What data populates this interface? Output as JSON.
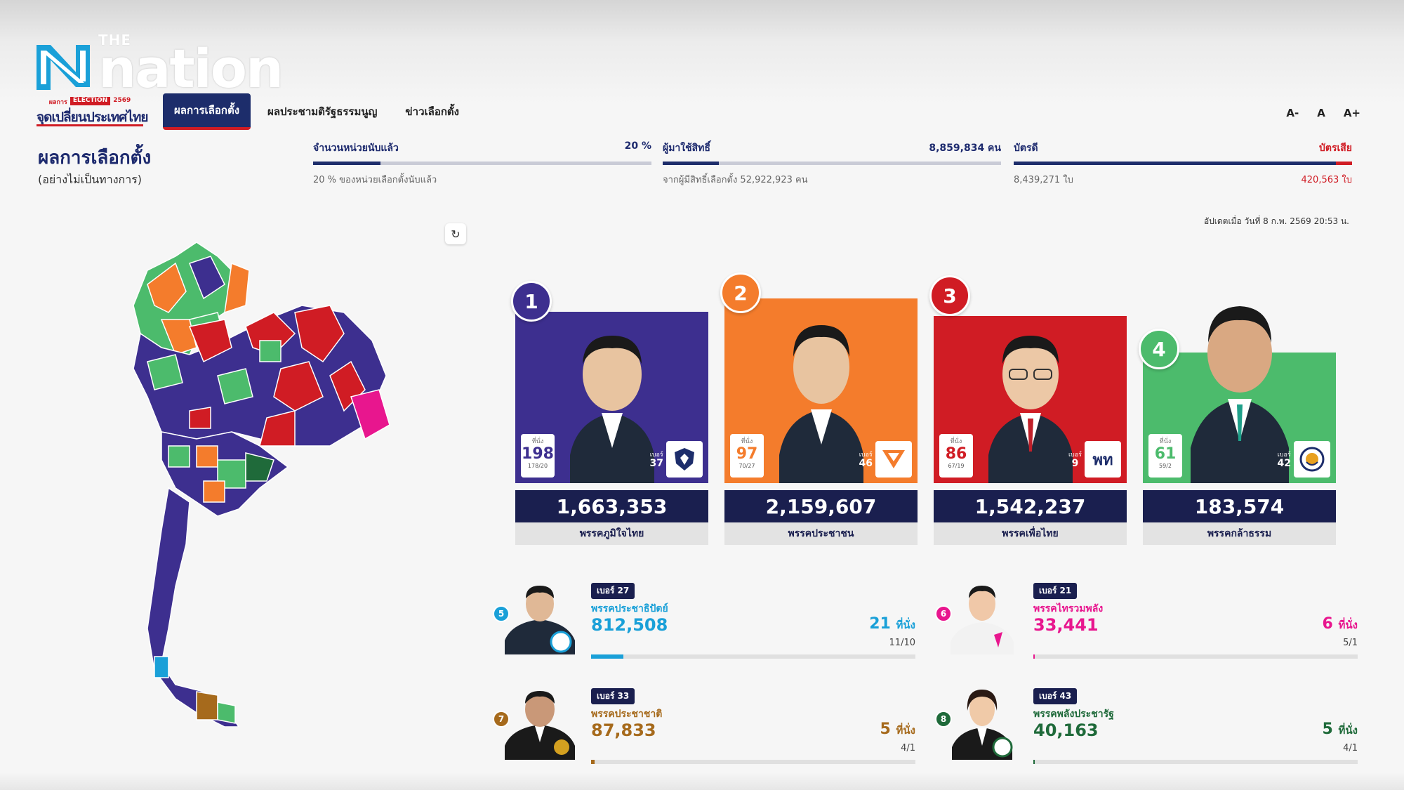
{
  "brand": {
    "the": "THE",
    "name": "nation"
  },
  "election_logo": {
    "top_left": "ผลการ",
    "badge": "ELECTION",
    "year": "2569",
    "main": "จุดเปลี่ยนประเทศไทย"
  },
  "nav": {
    "tabs": [
      {
        "label": "ผลการเลือกตั้ง",
        "active": true
      },
      {
        "label": "ผลประชามติรัฐธรรมนูญ",
        "active": false
      },
      {
        "label": "ข่าวเลือกตั้ง",
        "active": false
      }
    ]
  },
  "font_controls": [
    "A-",
    "A",
    "A+"
  ],
  "page": {
    "title": "ผลการเลือกตั้ง",
    "subtitle": "(อย่างไม่เป็นทางการ)"
  },
  "stats": {
    "counted": {
      "label": "จำนวนหน่วยนับแล้ว",
      "value": "20 %",
      "sub": "20 % ของหน่วยเลือกตั้งนับแล้ว",
      "fraction": 0.2
    },
    "voters": {
      "label": "ผู้มาใช้สิทธิ์",
      "value": "8,859,834 คน",
      "sub": "จากผู้มีสิทธิ์เลือกตั้ง 52,922,923 คน",
      "fraction": 0.167
    },
    "ballots": {
      "label": "บัตรดี",
      "label_right": "บัตรเสีย",
      "good": "8,439,271 ใบ",
      "bad": "420,563 ใบ",
      "fraction": 0.953
    }
  },
  "updated": "อัปเดตเมื่อ วันที่ 8 ก.พ. 2569 20:53 น.",
  "colors": {
    "navy": "#1a1f4f",
    "purple": "#3d2f8f",
    "orange": "#f47c2c",
    "red": "#d01c24",
    "green": "#4cbb6c",
    "pink": "#e8168e",
    "blue": "#1aa0d8",
    "brown": "#a66a1c",
    "darkgreen": "#1f6a3a"
  },
  "top_parties": [
    {
      "rank": "1",
      "party": "พรรคภูมิใจไทย",
      "votes": "1,663,353",
      "seats_label": "ที่นั่ง",
      "seats": "198",
      "seats_detail": "178/20",
      "number_label": "เบอร์",
      "number": "37",
      "logo": "shield-icon",
      "color": "#3d2f8f",
      "rank_color": "#3d2f8f"
    },
    {
      "rank": "2",
      "party": "พรรคประชาชน",
      "votes": "2,159,607",
      "seats_label": "ที่นั่ง",
      "seats": "97",
      "seats_detail": "70/27",
      "number_label": "เบอร์",
      "number": "46",
      "logo": "people-party-icon",
      "color": "#f47c2c",
      "rank_color": "#f47c2c"
    },
    {
      "rank": "3",
      "party": "พรรคเพื่อไทย",
      "votes": "1,542,237",
      "seats_label": "ที่นั่ง",
      "seats": "86",
      "seats_detail": "67/19",
      "number_label": "เบอร์",
      "number": "9",
      "logo_text": "พท",
      "color": "#d01c24",
      "rank_color": "#d01c24"
    },
    {
      "rank": "4",
      "party": "พรรคกล้าธรรม",
      "votes": "183,574",
      "seats_label": "ที่นั่ง",
      "seats": "61",
      "seats_detail": "59/2",
      "number_label": "เบอร์",
      "number": "42",
      "logo": "kla-tham-icon",
      "color": "#4cbb6c",
      "rank_color": "#4cbb6c"
    }
  ],
  "other_parties": [
    {
      "rank": "5",
      "badge": "เบอร์ 27",
      "party": "พรรคประชาธิปัตย์",
      "votes": "812,508",
      "seats": "21",
      "seats_unit": "ที่นั่ง",
      "detail": "11/10",
      "color": "#1aa0d8",
      "fraction": 0.1
    },
    {
      "rank": "6",
      "badge": "เบอร์ 21",
      "party": "พรรคไทรวมพลัง",
      "votes": "33,441",
      "seats": "6",
      "seats_unit": "ที่นั่ง",
      "detail": "5/1",
      "color": "#e8168e",
      "fraction": 0.005
    },
    {
      "rank": "7",
      "badge": "เบอร์ 33",
      "party": "พรรคประชาชาติ",
      "votes": "87,833",
      "seats": "5",
      "seats_unit": "ที่นั่ง",
      "detail": "4/1",
      "color": "#a66a1c",
      "fraction": 0.01
    },
    {
      "rank": "8",
      "badge": "เบอร์ 43",
      "party": "พรรคพลังประชารัฐ",
      "votes": "40,163",
      "seats": "5",
      "seats_unit": "ที่นั่ง",
      "detail": "4/1",
      "color": "#1f6a3a",
      "fraction": 0.005
    }
  ]
}
